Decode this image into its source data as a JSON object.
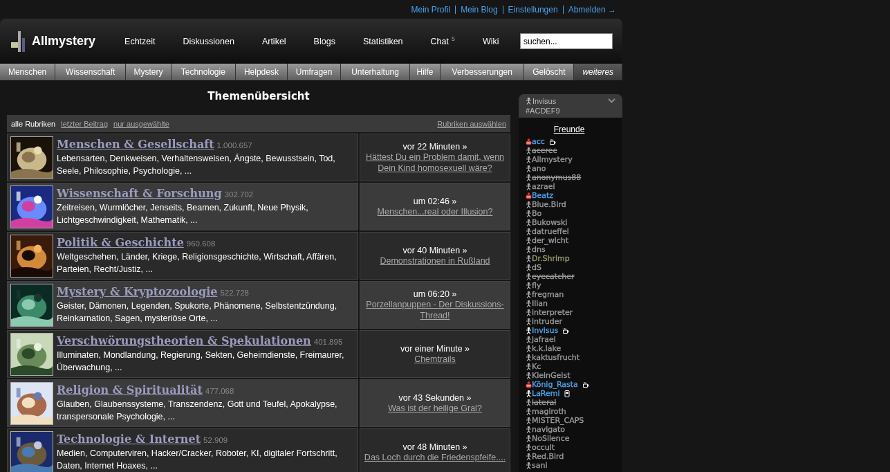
{
  "top_links": [
    "Mein Profil",
    "Mein Blog",
    "Einstellungen",
    "Abmelden →"
  ],
  "logo": "Allmystery",
  "main_nav": [
    {
      "label": "Echtzeit"
    },
    {
      "label": "Diskussionen"
    },
    {
      "label": "Artikel"
    },
    {
      "label": "Blogs"
    },
    {
      "label": "Statistiken"
    },
    {
      "label": "Chat",
      "badge": "5"
    },
    {
      "label": "Wiki"
    }
  ],
  "search": {
    "value": "suchen..."
  },
  "sub_nav": [
    {
      "label": "Menschen",
      "kind": "link"
    },
    {
      "label": "Wissenschaft",
      "kind": "link"
    },
    {
      "label": "Mystery",
      "kind": "link"
    },
    {
      "label": "Technologie",
      "kind": "link"
    },
    {
      "label": "Helpdesk",
      "kind": "link"
    },
    {
      "label": "Umfragen",
      "kind": "link"
    },
    {
      "label": "Unterhaltung",
      "kind": "link"
    },
    {
      "label": "Hilfe",
      "kind": "link"
    },
    {
      "label": "Verbesserungen",
      "kind": "link"
    },
    {
      "label": "Gelöscht",
      "kind": "link"
    },
    {
      "label": "weiteres",
      "kind": "more"
    }
  ],
  "page_title": "Themenübersicht",
  "filters": [
    {
      "label": "alle Rubriken",
      "selected": true
    },
    {
      "label": "letzter Beitrag",
      "selected": false
    },
    {
      "label": "nur ausgewählte",
      "selected": false
    }
  ],
  "select_link": "Rubriken auswählen",
  "categories": [
    {
      "title": "Menschen & Gesellschaft",
      "count": "1.000.657",
      "description": "Lebensarten, Denkweisen, Verhaltensweisen, Ängste, Bewusstsein, Tod, Seele, Philosophie, Psychologie, ...",
      "time": "vor 22 Minuten »",
      "last_post": "Hättest Du ein Problem damit, wenn Dein Kind homosexuell wäre?"
    },
    {
      "title": "Wissenschaft & Forschung",
      "count": "302.702",
      "description": "Zeitreisen, Wurmlöcher, Jenseits, Beamen, Zukunft, Neue Physik, Lichtgeschwindigkeit, Mathematik, ...",
      "time": "um 02:46 »",
      "last_post": "Menschen...real oder Illusion?"
    },
    {
      "title": "Politik & Geschichte",
      "count": "960.608",
      "description": "Weltgeschehen, Länder, Kriege, Religionsgeschichte, Wirtschaft, Affären, Parteien, Recht/Justiz, ...",
      "time": "vor 40 Minuten »",
      "last_post": "Demonstrationen in Rußland"
    },
    {
      "title": "Mystery & Kryptozoologie",
      "count": "522.728",
      "description": "Geister, Dämonen, Legenden, Spukorte, Phänomene, Selbstentzündung, Reinkarnation, Sagen, mysteriöse Orte, ...",
      "time": "um 06:20 »",
      "last_post": "Porzellanpuppen - Der Diskussions-Thread!"
    },
    {
      "title": "Verschwörungstheorien & Spekulationen",
      "count": "401.895",
      "description": "Illuminaten, Mondlandung, Regierung, Sekten, Geheimdienste, Freimaurer, Überwachung, ...",
      "time": "vor einer Minute »",
      "last_post": "Chemtrails"
    },
    {
      "title": "Religion & Spiritualität",
      "count": "477.068",
      "description": "Glauben, Glaubenssysteme, Transzendenz, Gott und Teufel, Apokalypse, transpersonale Psychologie, ...",
      "time": "vor 43 Sekunden »",
      "last_post": "Was ist der heilige Gral?"
    },
    {
      "title": "Technologie & Internet",
      "count": "52.909",
      "description": "Medien, Computerviren, Hacker/Cracker, Roboter, KI, digitaler Fortschritt, Daten, Internet Hoaxes, ...",
      "time": "vor 48 Minuten »",
      "last_post": "Das Loch durch die Friedenspfeife...."
    }
  ],
  "user_panel": {
    "name": "Invisus",
    "color_code": "#ACDEF9",
    "expanded": true
  },
  "friends_title": "Freunde",
  "friends": [
    {
      "name": "acc",
      "kind": "busy",
      "deleted": false,
      "color": "#4aa3ee",
      "activity": {
        "kind": "cup"
      }
    },
    {
      "name": "acerec",
      "kind": "offline",
      "deleted": true,
      "color": "#9a9a9a"
    },
    {
      "name": "Allmystery",
      "kind": "offline",
      "deleted": false,
      "color": "#9a9a9a"
    },
    {
      "name": "ano",
      "kind": "offline",
      "deleted": false,
      "color": "#9a9a9a"
    },
    {
      "name": "anonymus88",
      "kind": "offline",
      "deleted": true,
      "color": "#9a9a9a"
    },
    {
      "name": "azrael",
      "kind": "offline",
      "deleted": false,
      "color": "#9a9a9a"
    },
    {
      "name": "Beatz",
      "kind": "busy",
      "deleted": false,
      "color": "#4aa3ee"
    },
    {
      "name": "Blue.Bird",
      "kind": "offline",
      "deleted": false,
      "color": "#9a9a9a"
    },
    {
      "name": "Bo",
      "kind": "offline",
      "deleted": false,
      "color": "#9a9a9a"
    },
    {
      "name": "Bukowski",
      "kind": "offline",
      "deleted": false,
      "color": "#9a9a9a"
    },
    {
      "name": "datrueffel",
      "kind": "offline",
      "deleted": false,
      "color": "#9a9a9a"
    },
    {
      "name": "der_wicht",
      "kind": "offline",
      "deleted": false,
      "color": "#9a9a9a"
    },
    {
      "name": "dns",
      "kind": "offline",
      "deleted": false,
      "color": "#9a9a9a"
    },
    {
      "name": "Dr.Shrimp",
      "kind": "offline",
      "deleted": false,
      "color": "#9a9a6a"
    },
    {
      "name": "dS",
      "kind": "offline",
      "deleted": false,
      "color": "#9a9a9a"
    },
    {
      "name": "eyecatcher",
      "kind": "offline",
      "deleted": true,
      "color": "#9a9a9a"
    },
    {
      "name": "fly",
      "kind": "offline",
      "deleted": false,
      "color": "#9a9a9a"
    },
    {
      "name": "fregman",
      "kind": "offline",
      "deleted": false,
      "color": "#9a9a9a"
    },
    {
      "name": "Ilian",
      "kind": "offline",
      "deleted": false,
      "color": "#9a9a9a"
    },
    {
      "name": "interpreter",
      "kind": "offline",
      "deleted": false,
      "color": "#9a9a9a"
    },
    {
      "name": "intruder",
      "kind": "offline",
      "deleted": false,
      "color": "#9a9a9a"
    },
    {
      "name": "Invisus",
      "kind": "online",
      "deleted": false,
      "color": "#4aa3ee",
      "activity": {
        "kind": "cup"
      }
    },
    {
      "name": "jafrael",
      "kind": "offline",
      "deleted": false,
      "color": "#9a9a9a"
    },
    {
      "name": "k.k.lake",
      "kind": "offline",
      "deleted": false,
      "color": "#9a9a9a"
    },
    {
      "name": "kaktusfrucht",
      "kind": "offline",
      "deleted": false,
      "color": "#9a9a9a"
    },
    {
      "name": "Kc",
      "kind": "offline",
      "deleted": false,
      "color": "#9a9a9a"
    },
    {
      "name": "KleinGeist",
      "kind": "offline",
      "deleted": false,
      "color": "#9a9a9a"
    },
    {
      "name": "König_Rasta",
      "kind": "busy",
      "deleted": false,
      "color": "#4aa3ee",
      "activity": {
        "kind": "cup"
      }
    },
    {
      "name": "LaRemi",
      "kind": "online",
      "deleted": false,
      "color": "#4aa3ee",
      "activity": {
        "kind": "phone"
      }
    },
    {
      "name": "lateral",
      "kind": "offline",
      "deleted": true,
      "color": "#9a9a9a"
    },
    {
      "name": "magiroth",
      "kind": "offline",
      "deleted": false,
      "color": "#9a9a9a"
    },
    {
      "name": "MISTER_CAPS",
      "kind": "offline",
      "deleted": false,
      "color": "#9a9a9a"
    },
    {
      "name": "navigato",
      "kind": "offline",
      "deleted": false,
      "color": "#9a9a9a"
    },
    {
      "name": "NoSilence",
      "kind": "offline",
      "deleted": false,
      "color": "#9a9a9a"
    },
    {
      "name": "occult",
      "kind": "offline",
      "deleted": false,
      "color": "#9a9a9a"
    },
    {
      "name": "Red.Bird",
      "kind": "offline",
      "deleted": false,
      "color": "#9a9a9a"
    },
    {
      "name": "sani",
      "kind": "offline",
      "deleted": false,
      "color": "#9a9a9a"
    }
  ]
}
